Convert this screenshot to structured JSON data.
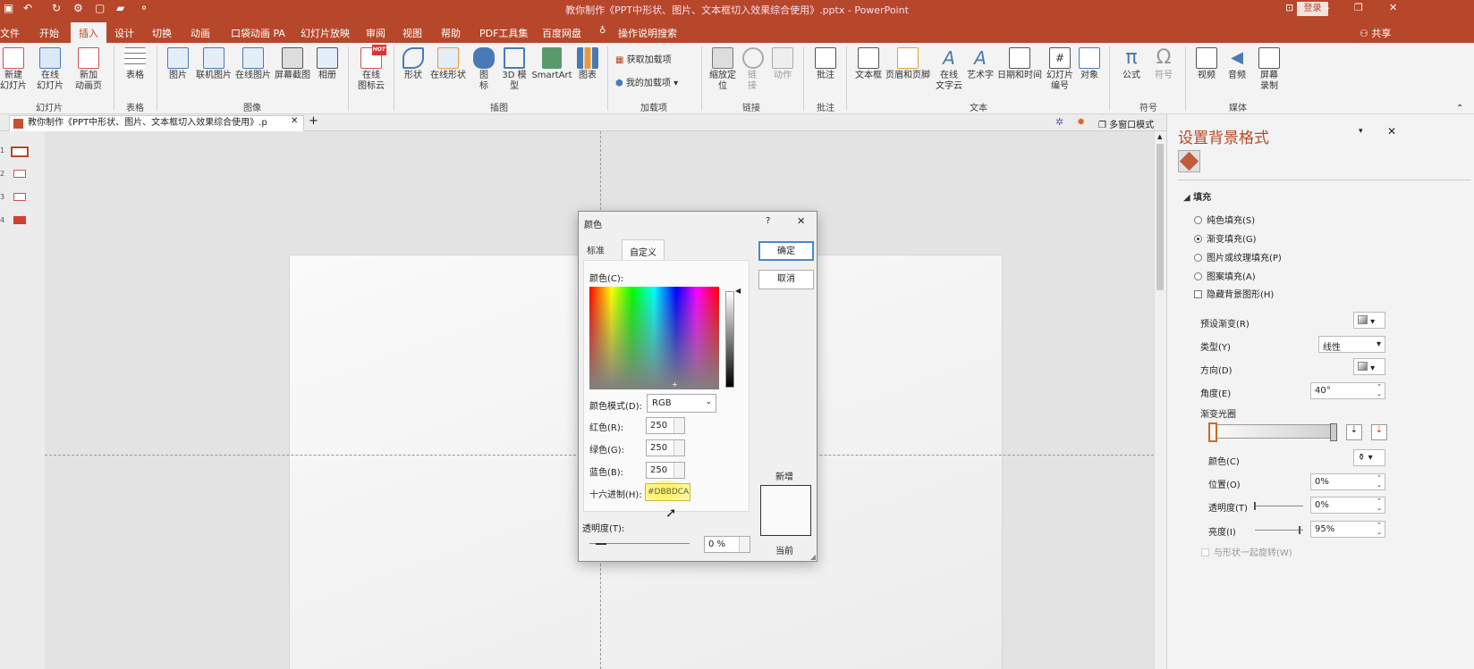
{
  "titlebar": {
    "title": "教你制作《PPT中形状、图片、文本框切入效果综合使用》.pptx - PowerPoint",
    "login": "登录"
  },
  "tabs": [
    {
      "label": "文件"
    },
    {
      "label": "开始"
    },
    {
      "label": "插入"
    },
    {
      "label": "设计"
    },
    {
      "label": "切换"
    },
    {
      "label": "动画"
    },
    {
      "label": "口袋动画 PA"
    },
    {
      "label": "幻灯片放映"
    },
    {
      "label": "审阅"
    },
    {
      "label": "视图"
    },
    {
      "label": "帮助"
    },
    {
      "label": "PDF工具集"
    },
    {
      "label": "百度网盘"
    },
    {
      "label": "操作说明搜索"
    }
  ],
  "share": "共享",
  "ribbon": {
    "new_slide": "新建\n幻灯片",
    "online_slide": "在线\n幻灯片",
    "add_anim_page": "新加\n动画页",
    "table": "表格",
    "picture": "图片",
    "online_pic": "联机图片",
    "online_pic2": "在线图片",
    "screenshot": "屏幕截图",
    "album": "相册",
    "online_icon": "在线\n图标云",
    "shapes": "形状",
    "online_shapes": "在线形状",
    "icons": "图\n标",
    "model3d": "3D 模\n型",
    "smartart": "SmartArt",
    "chart": "图表",
    "get_addins": "获取加载项",
    "my_addins": "我的加载项",
    "zoom": "缩放定\n位",
    "link": "链\n接",
    "action": "动作",
    "comment": "批注",
    "textbox": "文本框",
    "header_footer": "页眉和页脚",
    "online_text": "在线\n文字云",
    "wordart": "艺术字",
    "datetime": "日期和时间",
    "slide_number": "幻灯片\n编号",
    "object": "对象",
    "equation": "公式",
    "symbol": "符号",
    "video": "视频",
    "audio": "音频",
    "screen_rec": "屏幕\n录制",
    "hot": "HOT",
    "groups": {
      "slides": "幻灯片",
      "tables": "表格",
      "images": "图像",
      "illustrations": "插图",
      "addins": "加载项",
      "links": "链接",
      "comments": "批注",
      "text": "文本",
      "symbols": "符号",
      "media": "媒体"
    }
  },
  "doc_tab": {
    "title": "教你制作《PPT中形状、图片、文本框切入效果综合使用》.p",
    "multiwin": "多窗口模式"
  },
  "thumbs": [
    "1",
    "2",
    "3",
    "4"
  ],
  "pane": {
    "title": "设置背景格式",
    "section_fill": "填充",
    "solid": "纯色填充(S)",
    "gradient": "渐变填充(G)",
    "picture": "图片或纹理填充(P)",
    "pattern": "图案填充(A)",
    "hide_bg": "隐藏背景图形(H)",
    "preset": "预设渐变(R)",
    "type": "类型(Y)",
    "type_value": "线性",
    "direction": "方向(D)",
    "angle": "角度(E)",
    "angle_value": "40°",
    "stops": "渐变光圈",
    "color": "颜色(C)",
    "position": "位置(O)",
    "position_value": "0%",
    "transparency": "透明度(T)",
    "transparency_value": "0%",
    "brightness": "亮度(I)",
    "brightness_value": "95%",
    "rotate": "与形状一起旋转(W)"
  },
  "dialog": {
    "title": "颜色",
    "help": "?",
    "close": "✕",
    "tab_standard": "标准",
    "tab_custom": "自定义",
    "colors_label": "颜色(C):",
    "mode_label": "颜色模式(D):",
    "mode_value": "RGB",
    "red_label": "红色(R):",
    "red": "250",
    "green_label": "绿色(G):",
    "green": "250",
    "blue_label": "蓝色(B):",
    "blue": "250",
    "hex_label": "十六进制(H):",
    "hex": "#DBBDCA",
    "transparency_label": "透明度(T):",
    "transparency": "0 %",
    "ok": "确定",
    "cancel": "取消",
    "new": "新增",
    "current": "当前"
  },
  "colors": {
    "accent": "#b7472a",
    "ribbon": "#f3f3f3",
    "highlight": "#fff45a"
  }
}
